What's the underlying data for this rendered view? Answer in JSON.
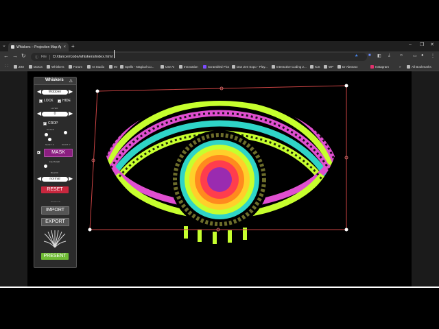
{
  "browser": {
    "tab_title": "Whiskers – Projection Map Ap...",
    "url_label": "File",
    "url": "D:/dancer/code/whiskers/index.html",
    "bookmarks": [
      {
        "label": "ZIM",
        "icon": "zim-icon"
      },
      {
        "label": "DOCS",
        "icon": "docs-icon"
      },
      {
        "label": "Whiskers",
        "icon": "whiskers-icon"
      },
      {
        "label": "Forum",
        "icon": "forum-icon"
      },
      {
        "label": "AI Studio",
        "icon": "ai-studio-icon"
      },
      {
        "label": "IM",
        "icon": "im-icon"
      },
      {
        "label": "Spells - Magical Co...",
        "icon": "spells-icon"
      },
      {
        "label": "Use AI",
        "icon": "use-ai-icon"
      },
      {
        "label": "Innovation",
        "icon": "innovation-icon"
      },
      {
        "label": "Scrambled Pics",
        "icon": "scrambled-pics-icon"
      },
      {
        "label": "Dan Zen Expo - Play...",
        "icon": "dan-zen-expo-icon"
      },
      {
        "label": "Interactive Coding 2...",
        "icon": "interactive-coding-icon"
      },
      {
        "label": "ICS",
        "icon": "ics-icon"
      },
      {
        "label": "WP",
        "icon": "wp-icon"
      },
      {
        "label": "Dr Abstract",
        "icon": "dr-abstract-icon"
      },
      {
        "label": "Instagram",
        "icon": "instagram-icon"
      }
    ],
    "all_bookmarks": "All Bookmarks"
  },
  "panel": {
    "title": "Whiskers",
    "effect": "Wobbler",
    "lock_label": "LOCK",
    "hide_label": "HIDE",
    "layer_label": "LAYER",
    "layer_value": "0",
    "crop_label": "CROP",
    "scale_label": "SCALE",
    "shift_x_label": "SHIFT X",
    "shift_y_label": "SHIFT Y",
    "mask_label": "MASK",
    "feather_label": "FEATHER",
    "blend_label": "BLEND",
    "blend_value": "normal",
    "reset_label": "RESET",
    "remove_label": "REMOVE",
    "import_label": "IMPORT",
    "export_label": "EXPORT",
    "present_label": "PRESENT",
    "accent_colors": {
      "mask": "#8b1e80",
      "reset": "#c8273e",
      "present": "#6fbb34"
    }
  }
}
